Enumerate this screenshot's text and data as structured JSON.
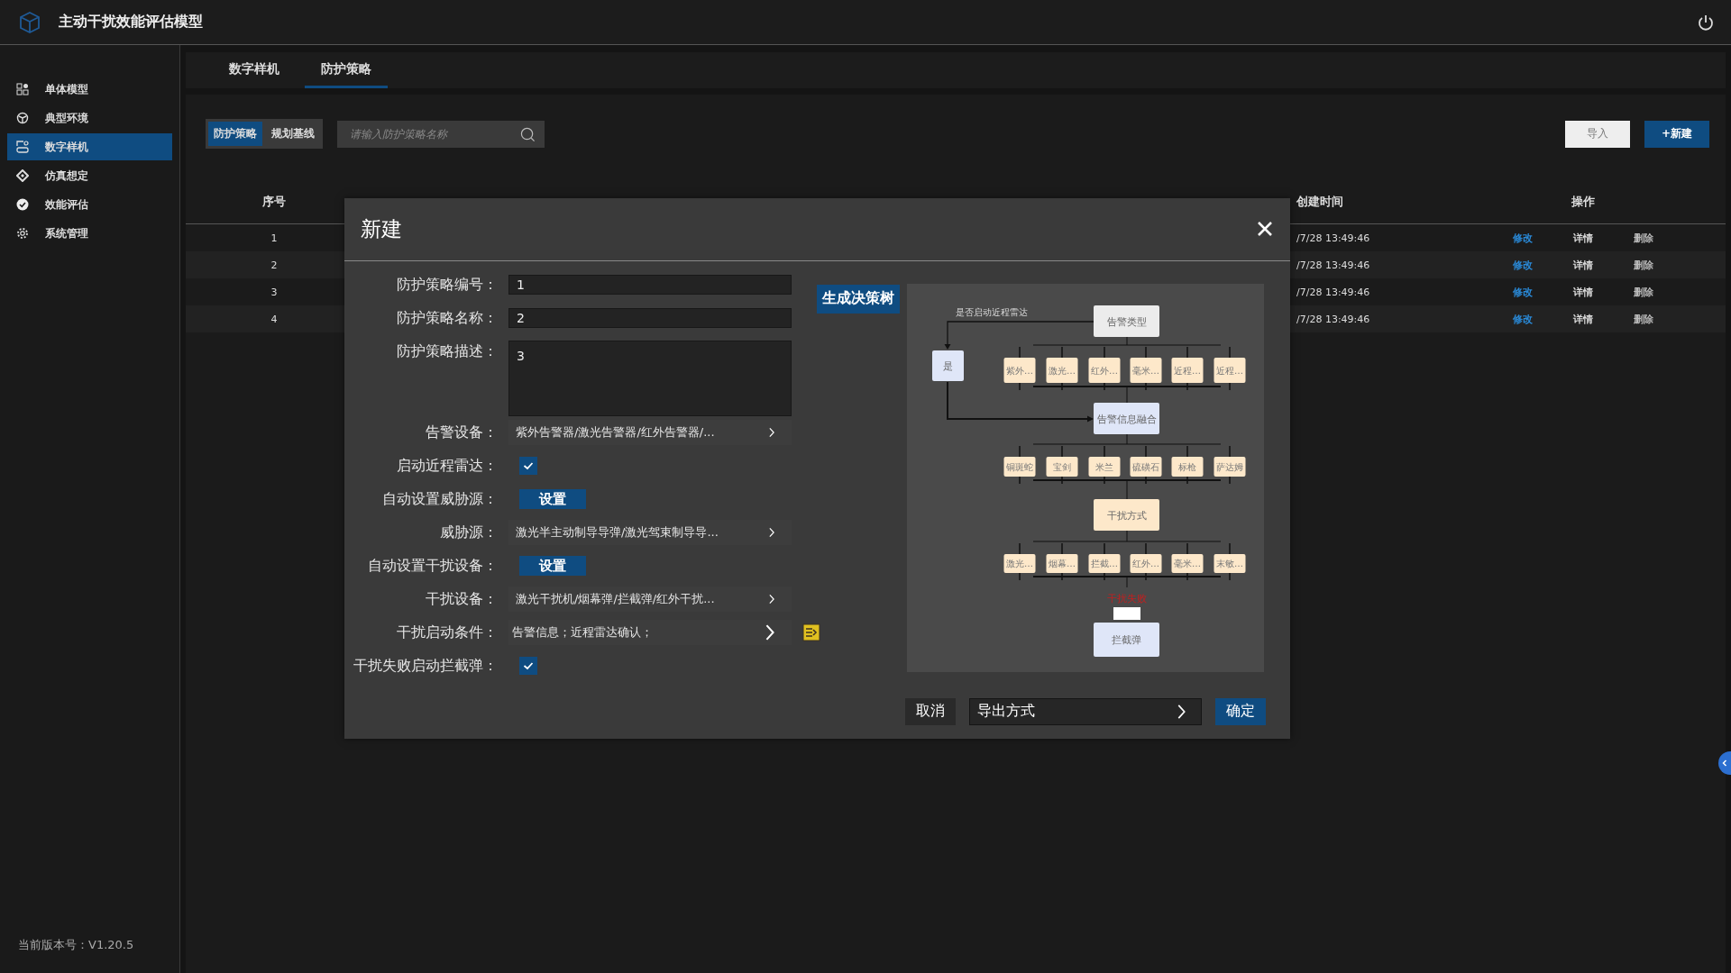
{
  "app": {
    "title": "主动干扰效能评估模型",
    "version": "当前版本号：V1.20.5"
  },
  "sidebar": {
    "items": [
      {
        "label": "单体模型",
        "selected": false
      },
      {
        "label": "典型环境",
        "selected": false
      },
      {
        "label": "数字样机",
        "selected": true
      },
      {
        "label": "仿真想定",
        "selected": false
      },
      {
        "label": "效能评估",
        "selected": false
      },
      {
        "label": "系统管理",
        "selected": false
      }
    ]
  },
  "tabs": [
    {
      "label": "数字样机",
      "selected": false
    },
    {
      "label": "防护策略",
      "selected": true
    }
  ],
  "toolbar": {
    "segments": [
      {
        "label": "防护策略",
        "selected": true
      },
      {
        "label": "规划基线",
        "selected": false
      }
    ],
    "search": {
      "placeholder": "请输入防护策略名称"
    },
    "buttons": [
      {
        "label": "导入",
        "kind": "secondary"
      },
      {
        "label": "+新建",
        "kind": "primary"
      }
    ]
  },
  "table": {
    "columns": [
      "序号",
      "创建时间",
      "操作"
    ],
    "rows": [
      {
        "index": "1",
        "created": "/7/28 13:49:46",
        "actions": [
          {
            "label": "修改",
            "kind": "edit"
          },
          {
            "label": "详情",
            "kind": "detail"
          },
          {
            "label": "删除",
            "kind": "delete"
          }
        ]
      },
      {
        "index": "2",
        "created": "/7/28 13:49:46",
        "actions": [
          {
            "label": "修改",
            "kind": "edit"
          },
          {
            "label": "详情",
            "kind": "detail"
          },
          {
            "label": "删除",
            "kind": "delete"
          }
        ]
      },
      {
        "index": "3",
        "created": "/7/28 13:49:46",
        "actions": [
          {
            "label": "修改",
            "kind": "edit"
          },
          {
            "label": "详情",
            "kind": "detail"
          },
          {
            "label": "删除",
            "kind": "delete"
          }
        ]
      },
      {
        "index": "4",
        "created": "/7/28 13:49:46",
        "actions": [
          {
            "label": "修改",
            "kind": "edit"
          },
          {
            "label": "详情",
            "kind": "detail"
          },
          {
            "label": "删除",
            "kind": "delete"
          }
        ]
      }
    ]
  },
  "dialog": {
    "title": "新建",
    "fields": [
      {
        "kind": "input",
        "label": "防护策略编号：",
        "value": "1"
      },
      {
        "kind": "input",
        "label": "防护策略名称：",
        "value": "2"
      },
      {
        "kind": "textarea",
        "label": "防护策略描述：",
        "value": "3"
      },
      {
        "kind": "select",
        "label": "告警设备：",
        "value": "紫外告警器/激光告警器/红外告警器/..."
      },
      {
        "kind": "checkbox",
        "label": "启动近程雷达：",
        "checked": true
      },
      {
        "kind": "button",
        "label": "自动设置威胁源：",
        "button": "设置"
      },
      {
        "kind": "select",
        "label": "威胁源：",
        "value": "激光半主动制导导弹/激光驾束制导导..."
      },
      {
        "kind": "button",
        "label": "自动设置干扰设备：",
        "button": "设置"
      },
      {
        "kind": "select",
        "label": "干扰设备：",
        "value": "激光干扰机/烟幕弹/拦截弹/红外干扰..."
      },
      {
        "kind": "condition",
        "label": "干扰启动条件：",
        "value": "告警信息；近程雷达确认；"
      },
      {
        "kind": "checkbox",
        "label": "干扰失败启动拦截弹：",
        "checked": true
      }
    ],
    "generate_button": "生成决策树",
    "diagram": {
      "branch_label": "是否启动近程雷达",
      "branch_node": {
        "title": "是",
        "kind": "blue"
      },
      "stages": [
        {
          "title": "告警类型",
          "kind": "gray",
          "options": [
            "紫外…",
            "激光…",
            "红外…",
            "毫米…",
            "近程…",
            "近程…"
          ]
        },
        {
          "title": "告警信息融合",
          "kind": "blue",
          "options": [
            "铜斑蛇",
            "宝剑",
            "米兰",
            "硫磺石",
            "标枪",
            "萨达姆"
          ]
        },
        {
          "title": "干扰方式",
          "kind": "orange",
          "options": [
            "激光…",
            "烟幕…",
            "拦截…",
            "红外…",
            "毫米…",
            "末敏…"
          ]
        }
      ],
      "failure_label": "干扰失败",
      "final_node": {
        "title": "拦截弹",
        "kind": "blue"
      }
    },
    "footer": {
      "cancel": "取消",
      "export_select": "导出方式",
      "confirm": "确定"
    }
  }
}
